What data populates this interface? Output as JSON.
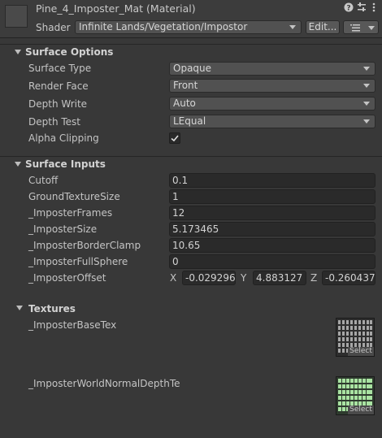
{
  "header": {
    "title": "Pine_4_Imposter_Mat (Material)",
    "shader_label": "Shader",
    "shader_value": "Infinite Lands/Vegetation/Impostor",
    "edit_label": "Edit..."
  },
  "surface_options": {
    "title": "Surface Options",
    "surface_type": {
      "label": "Surface Type",
      "value": "Opaque"
    },
    "render_face": {
      "label": "Render Face",
      "value": "Front"
    },
    "depth_write": {
      "label": "Depth Write",
      "value": "Auto"
    },
    "depth_test": {
      "label": "Depth Test",
      "value": "LEqual"
    },
    "alpha_clipping": {
      "label": "Alpha Clipping",
      "checked": true
    }
  },
  "surface_inputs": {
    "title": "Surface Inputs",
    "cutoff": {
      "label": "Cutoff",
      "value": "0.1"
    },
    "ground_texture_size": {
      "label": "GroundTextureSize",
      "value": "1"
    },
    "imposter_frames": {
      "label": "_ImposterFrames",
      "value": "12"
    },
    "imposter_size": {
      "label": "_ImposterSize",
      "value": "5.173465"
    },
    "imposter_border_clamp": {
      "label": "_ImposterBorderClamp",
      "value": "10.65"
    },
    "imposter_full_sphere": {
      "label": "_ImposterFullSphere",
      "value": "0"
    },
    "imposter_offset": {
      "label": "_ImposterOffset",
      "x_label": "X",
      "x": "-0.029296",
      "y_label": "Y",
      "y": "4.883127",
      "z_label": "Z",
      "z": "-0.260437"
    }
  },
  "textures": {
    "title": "Textures",
    "base_tex": {
      "label": "_ImposterBaseTex",
      "select": "Select"
    },
    "normal_depth_tex": {
      "label": "_ImposterWorldNormalDepthTe",
      "select": "Select"
    }
  },
  "icons": [
    "help-icon",
    "settings-sliders-icon",
    "more-icon",
    "foldout-arrow-icon",
    "checkmark-icon",
    "list-icon"
  ]
}
